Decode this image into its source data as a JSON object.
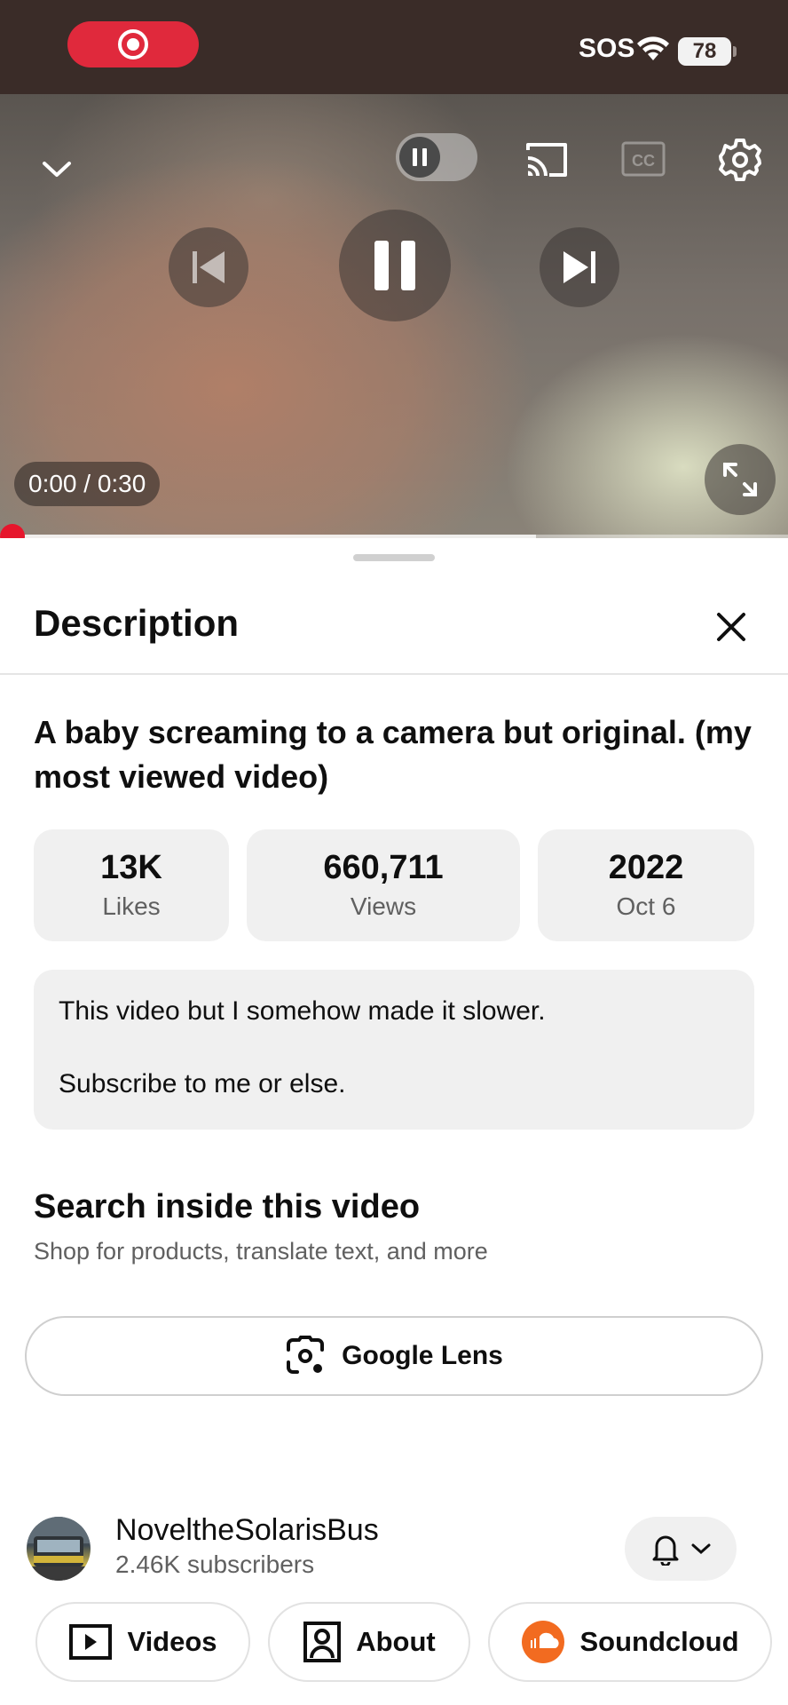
{
  "status_bar": {
    "carrier": "SOS",
    "battery_level": "78"
  },
  "player": {
    "time_display": "0:00 / 0:30",
    "progress_fraction": 0.0,
    "buffered_fraction": 0.68,
    "icons": [
      "minimize-chevron-icon",
      "autoplay-pause-icon",
      "cast-icon",
      "captions-icon",
      "settings-gear-icon",
      "previous-icon",
      "pause-icon",
      "next-icon",
      "fullscreen-icon"
    ]
  },
  "sheet": {
    "title": "Description",
    "video_title": "A baby screaming to a camera but original. (my most viewed video)",
    "stats": [
      {
        "value": "13K",
        "label": "Likes"
      },
      {
        "value": "660,711",
        "label": "Views"
      },
      {
        "value": "2022",
        "label": "Oct 6"
      }
    ],
    "description_lines": [
      "This video but I somehow made it slower.",
      "Subscribe to me or else."
    ],
    "search_section": {
      "title": "Search inside this video",
      "subtitle": "Shop for products, translate text, and more",
      "lens_label": "Google Lens"
    },
    "channel": {
      "name": "NoveltheSolarisBus",
      "subscribers": "2.46K subscribers"
    },
    "chips": [
      {
        "label": "Videos",
        "icon": "video-play-icon"
      },
      {
        "label": "About",
        "icon": "profile-icon"
      },
      {
        "label": "Soundcloud",
        "icon": "soundcloud-icon"
      }
    ]
  },
  "colors": {
    "accent_red": "#e6162c",
    "record_red": "#e0293c",
    "status_bar_bg": "#3a2c28",
    "chip_bg": "#f0f0f0"
  }
}
